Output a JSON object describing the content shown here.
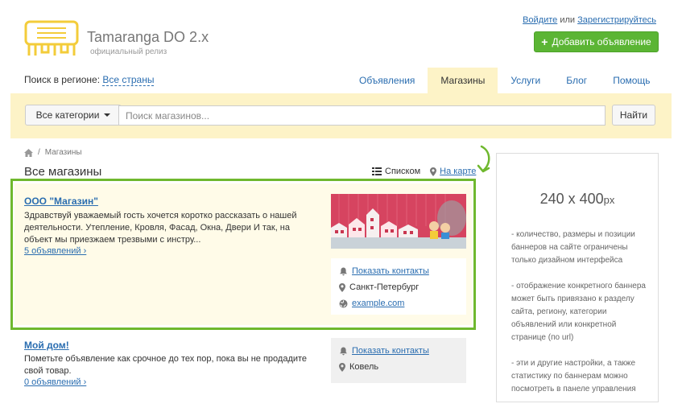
{
  "header": {
    "brand_title": "Tamaranga DO 2.x",
    "brand_subtitle": "официальный релиз",
    "login": "Войдите",
    "or": "или",
    "register": "Зарегистрируйтесь",
    "add_button": "Добавить объявление",
    "accent_color": "#5bb534",
    "logo_color": "#f3cc3a"
  },
  "region": {
    "label": "Поиск в регионе:",
    "value": "Все страны"
  },
  "tabs": [
    {
      "label": "Объявления",
      "active": false
    },
    {
      "label": "Магазины",
      "active": true
    },
    {
      "label": "Услуги",
      "active": false
    },
    {
      "label": "Блог",
      "active": false
    },
    {
      "label": "Помощь",
      "active": false
    }
  ],
  "search": {
    "category_label": "Все категории",
    "placeholder": "Поиск магазинов...",
    "value": "",
    "find_label": "Найти"
  },
  "breadcrumb": {
    "home_icon": "home-icon",
    "separator": "/",
    "current": "Магазины"
  },
  "page": {
    "title": "Все магазины",
    "view_list": "Списком",
    "view_map": "На карте"
  },
  "items": [
    {
      "title": "ООО \"Магазин\"",
      "description": "Здравствуй уважаемый гость хочется коротко рассказать о нашей деятельности. Утепление, Кровля, Фасад, Окна, Двери И так, на объект мы приезжаем трезвыми с инстру...",
      "count": "5 объявлений ›",
      "show_contacts": "Показать контакты",
      "city": "Санкт-Петербург",
      "website": "example.com"
    },
    {
      "title": "Мой дом!",
      "description": "Пометьте объявление как срочное до тех пор, пока вы не продадите свой товар.",
      "count": "0 объявлений ›",
      "show_contacts": "Показать контакты",
      "city": "Ковель"
    }
  ],
  "banner": {
    "size": "240 x 400",
    "unit": "px",
    "paragraphs": [
      "- количество, размеры и позиции баннеров на сайте ограничены только дизайном интерфейса",
      "- отображение конкретного баннера может быть привязано к разделу сайта, региону, категории объявлений или конкретной странице (по url)",
      "- эти и другие настройки, а также статистику по баннерам можно посмотреть в панеле управления"
    ]
  }
}
